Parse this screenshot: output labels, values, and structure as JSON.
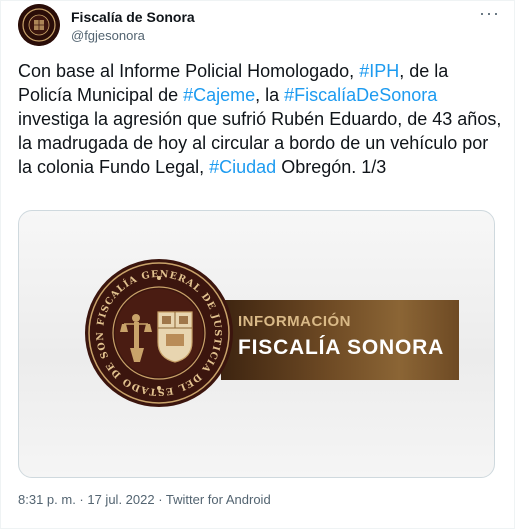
{
  "account": {
    "display_name": "Fiscalía de Sonora",
    "handle": "@fgjesonora",
    "avatar_icon": "fiscalia-seal-icon"
  },
  "more_icon": "more-options-icon",
  "tweet": {
    "segments": [
      {
        "text": "Con base al Informe Policial Homologado, ",
        "type": "text"
      },
      {
        "text": "#IPH",
        "type": "hashtag"
      },
      {
        "text": ", de la Policía Municipal de ",
        "type": "text"
      },
      {
        "text": "#Cajeme",
        "type": "hashtag"
      },
      {
        "text": ", la ",
        "type": "text"
      },
      {
        "text": "#FiscalíaDeSonora",
        "type": "hashtag"
      },
      {
        "text": " investiga la agresión que sufrió Rubén Eduardo, de 43 años, la madrugada de hoy al circular a bordo de un vehículo por la colonia Fundo Legal, ",
        "type": "text"
      },
      {
        "text": "#Ciudad",
        "type": "hashtag"
      },
      {
        "text": " Obregón. 1/3",
        "type": "text"
      }
    ]
  },
  "media": {
    "seal_ring_text": "FISCALÍA GENERAL DE JUSTICIA DEL ESTADO DE SONORA",
    "banner_line1": "INFORMACIÓN",
    "banner_line2": "FISCALÍA SONORA"
  },
  "meta": {
    "timestamp": "8:31 p. m. · 17 jul. 2022 · Twitter for Android"
  },
  "colors": {
    "link": "#1d9bf0",
    "text": "#0f1419",
    "muted": "#536471",
    "seal_brown": "#3b150e",
    "gold": "#c9a36a"
  }
}
